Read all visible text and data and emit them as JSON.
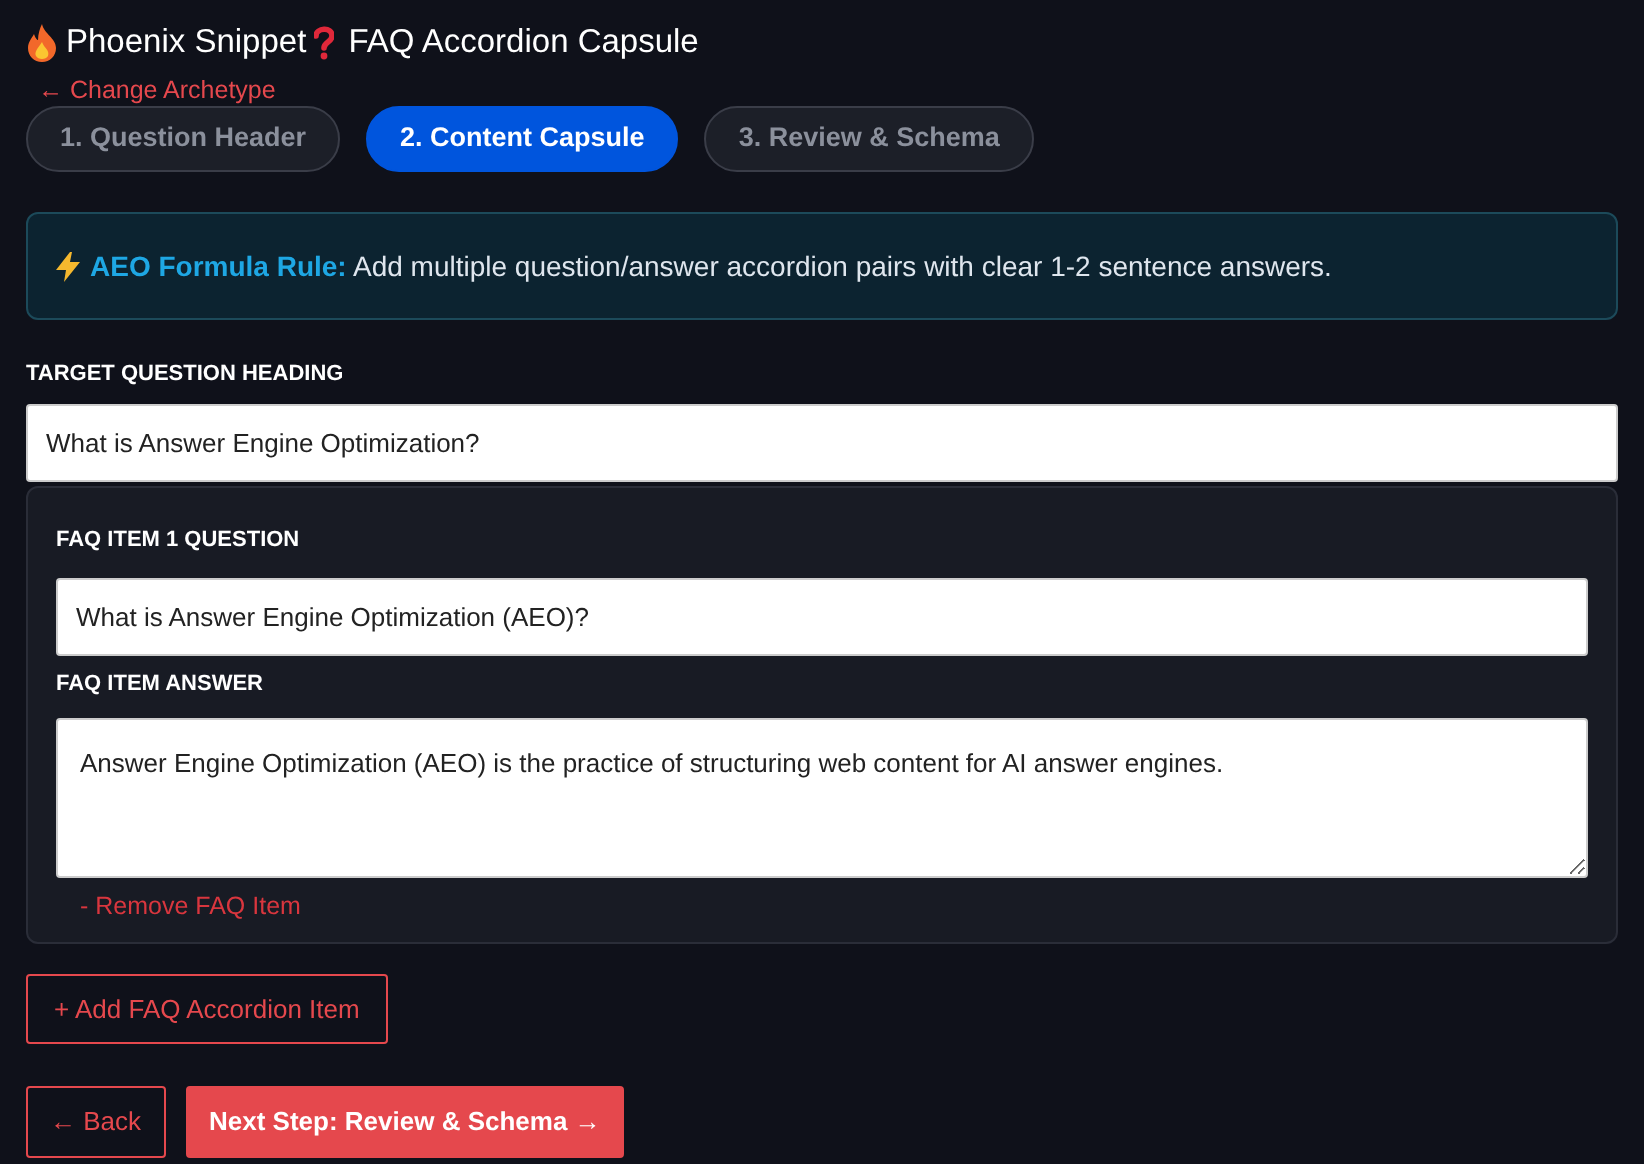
{
  "header": {
    "brand": "Phoenix Snippet",
    "name": "FAQ Accordion Capsule"
  },
  "back_link": "← Change Archetype",
  "steps": [
    {
      "label": "1. Question Header",
      "selected": false
    },
    {
      "label": "2. Content Capsule",
      "selected": true
    },
    {
      "label": "3. Review & Schema",
      "selected": false
    }
  ],
  "rule": {
    "title": "AEO Formula Rule:",
    "text": "Add multiple question/answer accordion pairs with clear 1-2 sentence answers."
  },
  "heading_field": {
    "label": "TARGET QUESTION HEADING",
    "value": "What is Answer Engine Optimization?"
  },
  "faq_items": [
    {
      "question_label": "FAQ ITEM 1 QUESTION",
      "question": "What is Answer Engine Optimization (AEO)?",
      "answer_label": "FAQ ITEM ANSWER",
      "answer": "Answer Engine Optimization (AEO) is the practice of structuring web content for AI answer engines.",
      "remove": "- Remove FAQ Item"
    }
  ],
  "add_button": "+ Add FAQ Accordion Item",
  "nav_buttons": [
    {
      "label": "← Back",
      "kind": "outline"
    },
    {
      "label": "Next Step: Review & Schema →",
      "kind": "primary"
    }
  ]
}
